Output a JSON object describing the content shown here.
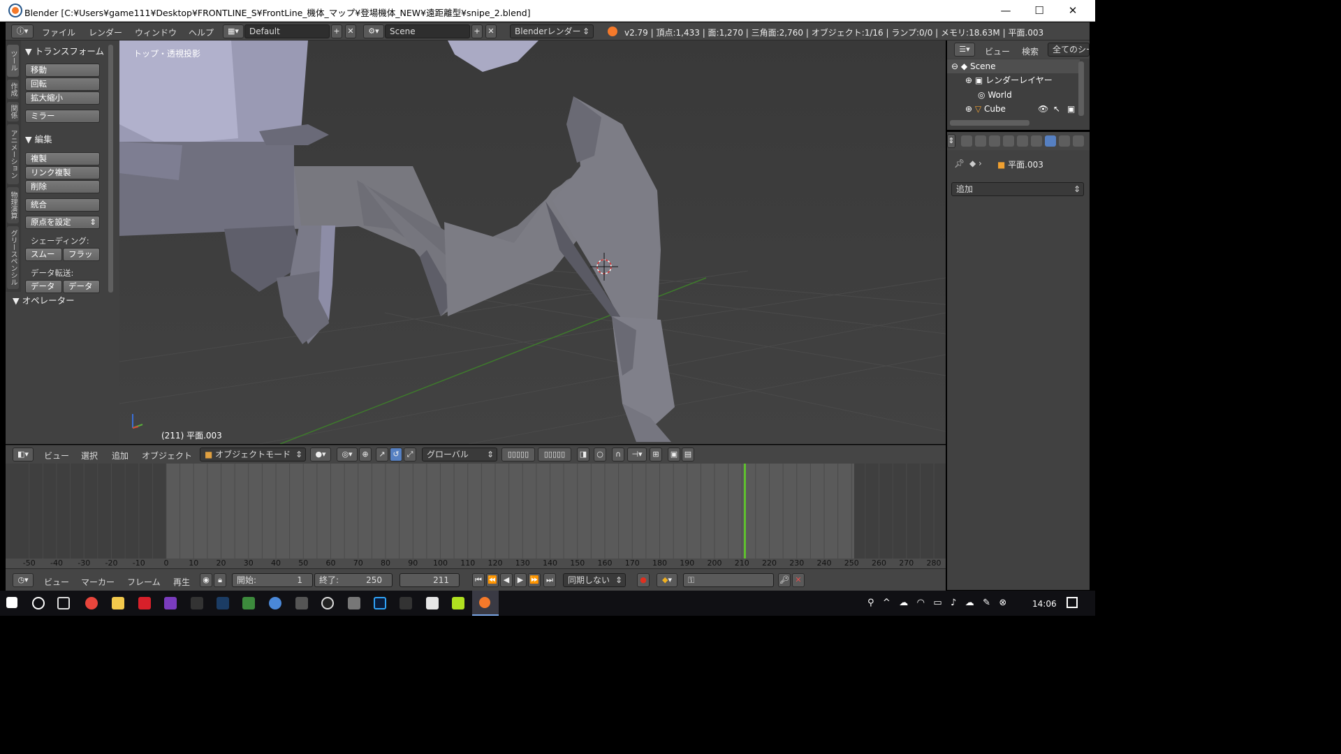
{
  "window": {
    "title": "Blender [C:¥Users¥game111¥Desktop¥FRONTLINE_S¥FrontLine_機体_マップ¥登場機体_NEW¥遠距離型¥snipe_2.blend]",
    "minimize": "—",
    "maximize": "☐",
    "close": "✕"
  },
  "infobar": {
    "menus": [
      "ファイル",
      "レンダー",
      "ウィンドウ",
      "ヘルプ"
    ],
    "layout": "Default",
    "scene": "Scene",
    "engine": "Blenderレンダー",
    "stats": "v2.79 | 頂点:1,433 | 面:1,270 | 三角面:2,760 | オブジェクト:1/16 | ランプ:0/0 | メモリ:18.63M | 平面.003"
  },
  "toolshelf": {
    "tabs": [
      "ツール",
      "作成",
      "関係",
      "アニメーション",
      "物理演算",
      "グリースペンシル"
    ],
    "transform_header": "▼ トランスフォーム",
    "transform_buttons": [
      "移動",
      "回転",
      "拡大縮小"
    ],
    "mirror": "ミラー",
    "edit_header": "▼ 編集",
    "edit_buttons": [
      "複製",
      "リンク複製",
      "削除"
    ],
    "join": "統合",
    "set_origin": "原点を設定",
    "shading_label": "シェーディング:",
    "smooth": "スムー",
    "flat": "フラッ",
    "data_transfer_label": "データ転送:",
    "data1": "データ",
    "data2": "データ",
    "operator_header": "▼ オペレーター"
  },
  "viewport": {
    "view_label": "トップ・透視投影",
    "object_label": "(211) 平面.003"
  },
  "header3d": {
    "menus": [
      "ビュー",
      "選択",
      "追加",
      "オブジェクト"
    ],
    "mode": "オブジェクトモード",
    "orientation": "グローバル"
  },
  "timeline": {
    "ticks": [
      -50,
      -40,
      -30,
      -20,
      -10,
      0,
      10,
      20,
      30,
      40,
      50,
      60,
      70,
      80,
      90,
      100,
      110,
      120,
      130,
      140,
      150,
      160,
      170,
      180,
      190,
      200,
      210,
      220,
      230,
      240,
      250,
      260,
      270,
      280
    ],
    "current_frame": 211,
    "menus": [
      "ビュー",
      "マーカー",
      "フレーム",
      "再生"
    ],
    "start_label": "開始:",
    "start": "1",
    "end_label": "終了:",
    "end": "250",
    "frame": "211",
    "sync": "同期しない"
  },
  "outliner": {
    "menus": [
      "ビュー",
      "検索"
    ],
    "filter": "全てのシー",
    "rows": [
      "Scene",
      "レンダーレイヤー",
      "World",
      "Cube"
    ]
  },
  "properties": {
    "object_name": "平面.003",
    "add_label": "追加"
  },
  "taskbar": {
    "time": "14:06"
  }
}
